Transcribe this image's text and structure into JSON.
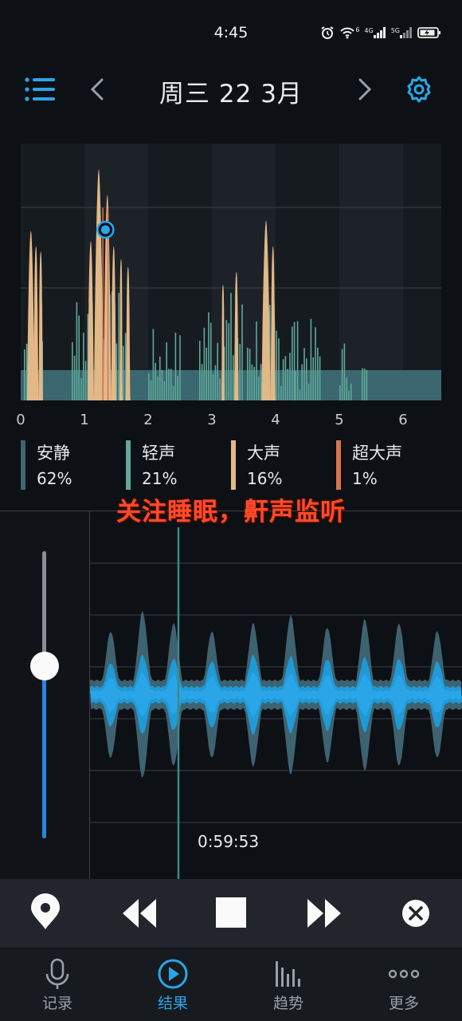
{
  "status_bar": {
    "time": "4:45",
    "icons": [
      "alarm-icon",
      "wifi-icon",
      "signal-4g-icon",
      "signal-5g-icon",
      "battery-icon"
    ],
    "wifi_label": "6",
    "net1_label": "4G",
    "net2_label": "5G"
  },
  "header": {
    "title": "周三 22 3月",
    "menu_icon": "list-menu-icon",
    "prev_icon": "chevron-left-icon",
    "next_icon": "chevron-right-icon",
    "settings_icon": "gear-icon"
  },
  "chart_data": {
    "type": "area",
    "x_ticks": [
      "0",
      "1",
      "2",
      "3",
      "4",
      "5",
      "6"
    ],
    "xlim": [
      0,
      6.6
    ],
    "grid": "horizontal",
    "marker_x": 1.33
  },
  "legend": [
    {
      "name": "安静",
      "pct": "62%",
      "color": "#3b6770"
    },
    {
      "name": "轻声",
      "pct": "21%",
      "color": "#5fa89a"
    },
    {
      "name": "大声",
      "pct": "16%",
      "color": "#e3b887"
    },
    {
      "name": "超大声",
      "pct": "1%",
      "color": "#d8734f"
    }
  ],
  "overlay_caption": "关注睡眠，鼾声监听",
  "player": {
    "volume_level": 0.6,
    "playback_time": "0:59:53"
  },
  "controls": [
    "location-pin-icon",
    "rewind-icon",
    "stop-icon",
    "fast-forward-icon",
    "close-circle-icon"
  ],
  "colors": {
    "accent": "#2aa6e8",
    "background": "#0d1014",
    "controls_bg": "#22262c"
  },
  "nav": [
    {
      "label": "记录",
      "icon": "microphone-icon",
      "active": false
    },
    {
      "label": "结果",
      "icon": "play-circle-icon",
      "active": true
    },
    {
      "label": "趋势",
      "icon": "bar-chart-icon",
      "active": false
    },
    {
      "label": "更多",
      "icon": "more-dots-icon",
      "active": false
    }
  ]
}
